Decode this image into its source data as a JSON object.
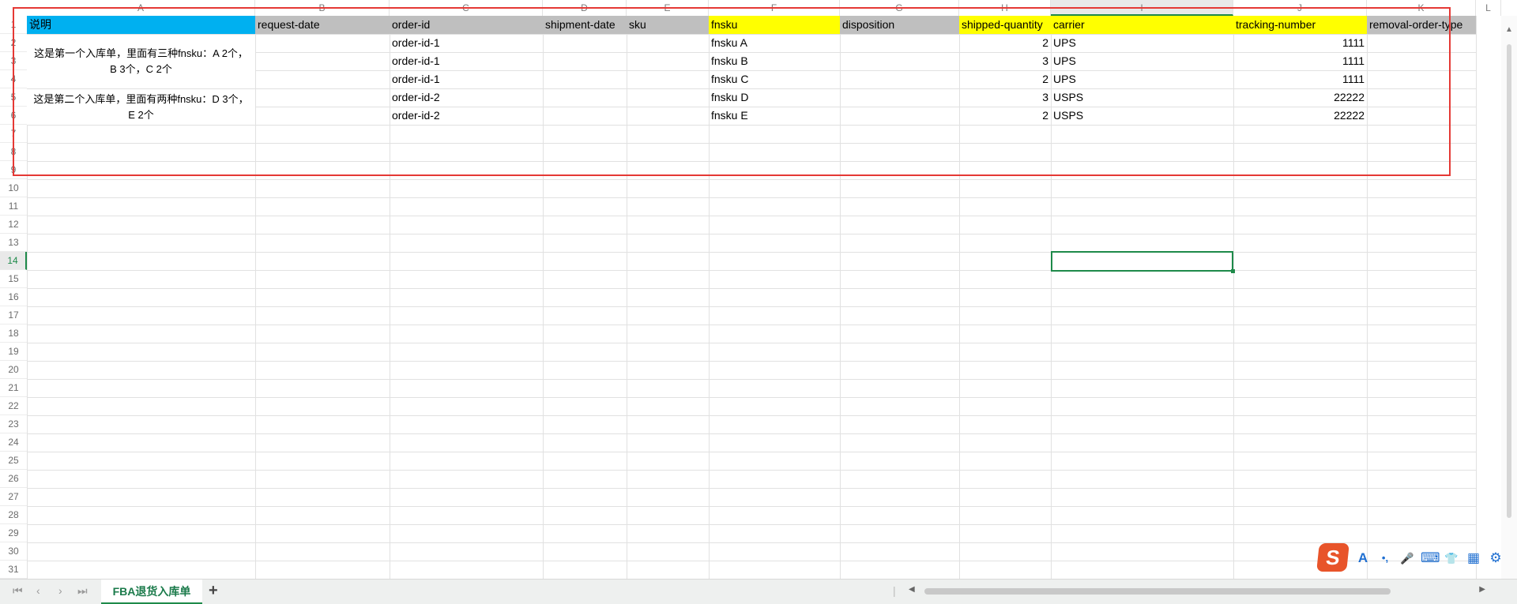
{
  "columns": [
    "A",
    "B",
    "C",
    "D",
    "E",
    "F",
    "G",
    "H",
    "I",
    "J",
    "K",
    "L"
  ],
  "rows": [
    "1",
    "2",
    "3",
    "4",
    "5",
    "6",
    "7",
    "8",
    "9",
    "10",
    "11",
    "12",
    "13",
    "14",
    "15",
    "16",
    "17",
    "18",
    "19",
    "20",
    "21",
    "22",
    "23",
    "24",
    "25",
    "26",
    "27",
    "28",
    "29",
    "30",
    "31"
  ],
  "header_row": {
    "A": "说明",
    "B": "request-date",
    "C": "order-id",
    "D": "shipment-date",
    "E": "sku",
    "F": "fnsku",
    "G": "disposition",
    "H": "shipped-quantity",
    "I": "carrier",
    "J": "tracking-number",
    "K": "removal-order-type"
  },
  "header_colors": {
    "blue": "#00b0f0",
    "gray": "#bfbfbf",
    "yellow": "#ffff00"
  },
  "notes": [
    "这是第一个入库单，里面有三种fnsku：A 2个，B 3个，C 2个",
    "这是第二个入库单，里面有两种fnsku：D 3个，E 2个"
  ],
  "data_rows": [
    {
      "order_id": "order-id-1",
      "fnsku": "fnsku A",
      "qty": "2",
      "carrier": "UPS",
      "tracking": "1111"
    },
    {
      "order_id": "order-id-1",
      "fnsku": "fnsku B",
      "qty": "3",
      "carrier": "UPS",
      "tracking": "1111"
    },
    {
      "order_id": "order-id-1",
      "fnsku": "fnsku C",
      "qty": "2",
      "carrier": "UPS",
      "tracking": "1111"
    },
    {
      "order_id": "order-id-2",
      "fnsku": "fnsku D",
      "qty": "3",
      "carrier": "USPS",
      "tracking": "22222"
    },
    {
      "order_id": "order-id-2",
      "fnsku": "fnsku E",
      "qty": "2",
      "carrier": "USPS",
      "tracking": "22222"
    }
  ],
  "selected_cell": "I14",
  "sheet_tab": "FBA退货入库单",
  "add_sheet": "+",
  "nav": {
    "first": "⏮",
    "prev": "‹",
    "next": "›",
    "last": "⏭"
  },
  "ime": {
    "logo": "S",
    "icons": [
      "A",
      "•,",
      "🎤",
      "⌨",
      "👕",
      "▦",
      "⚙"
    ]
  },
  "annotation_color": "#e53935"
}
